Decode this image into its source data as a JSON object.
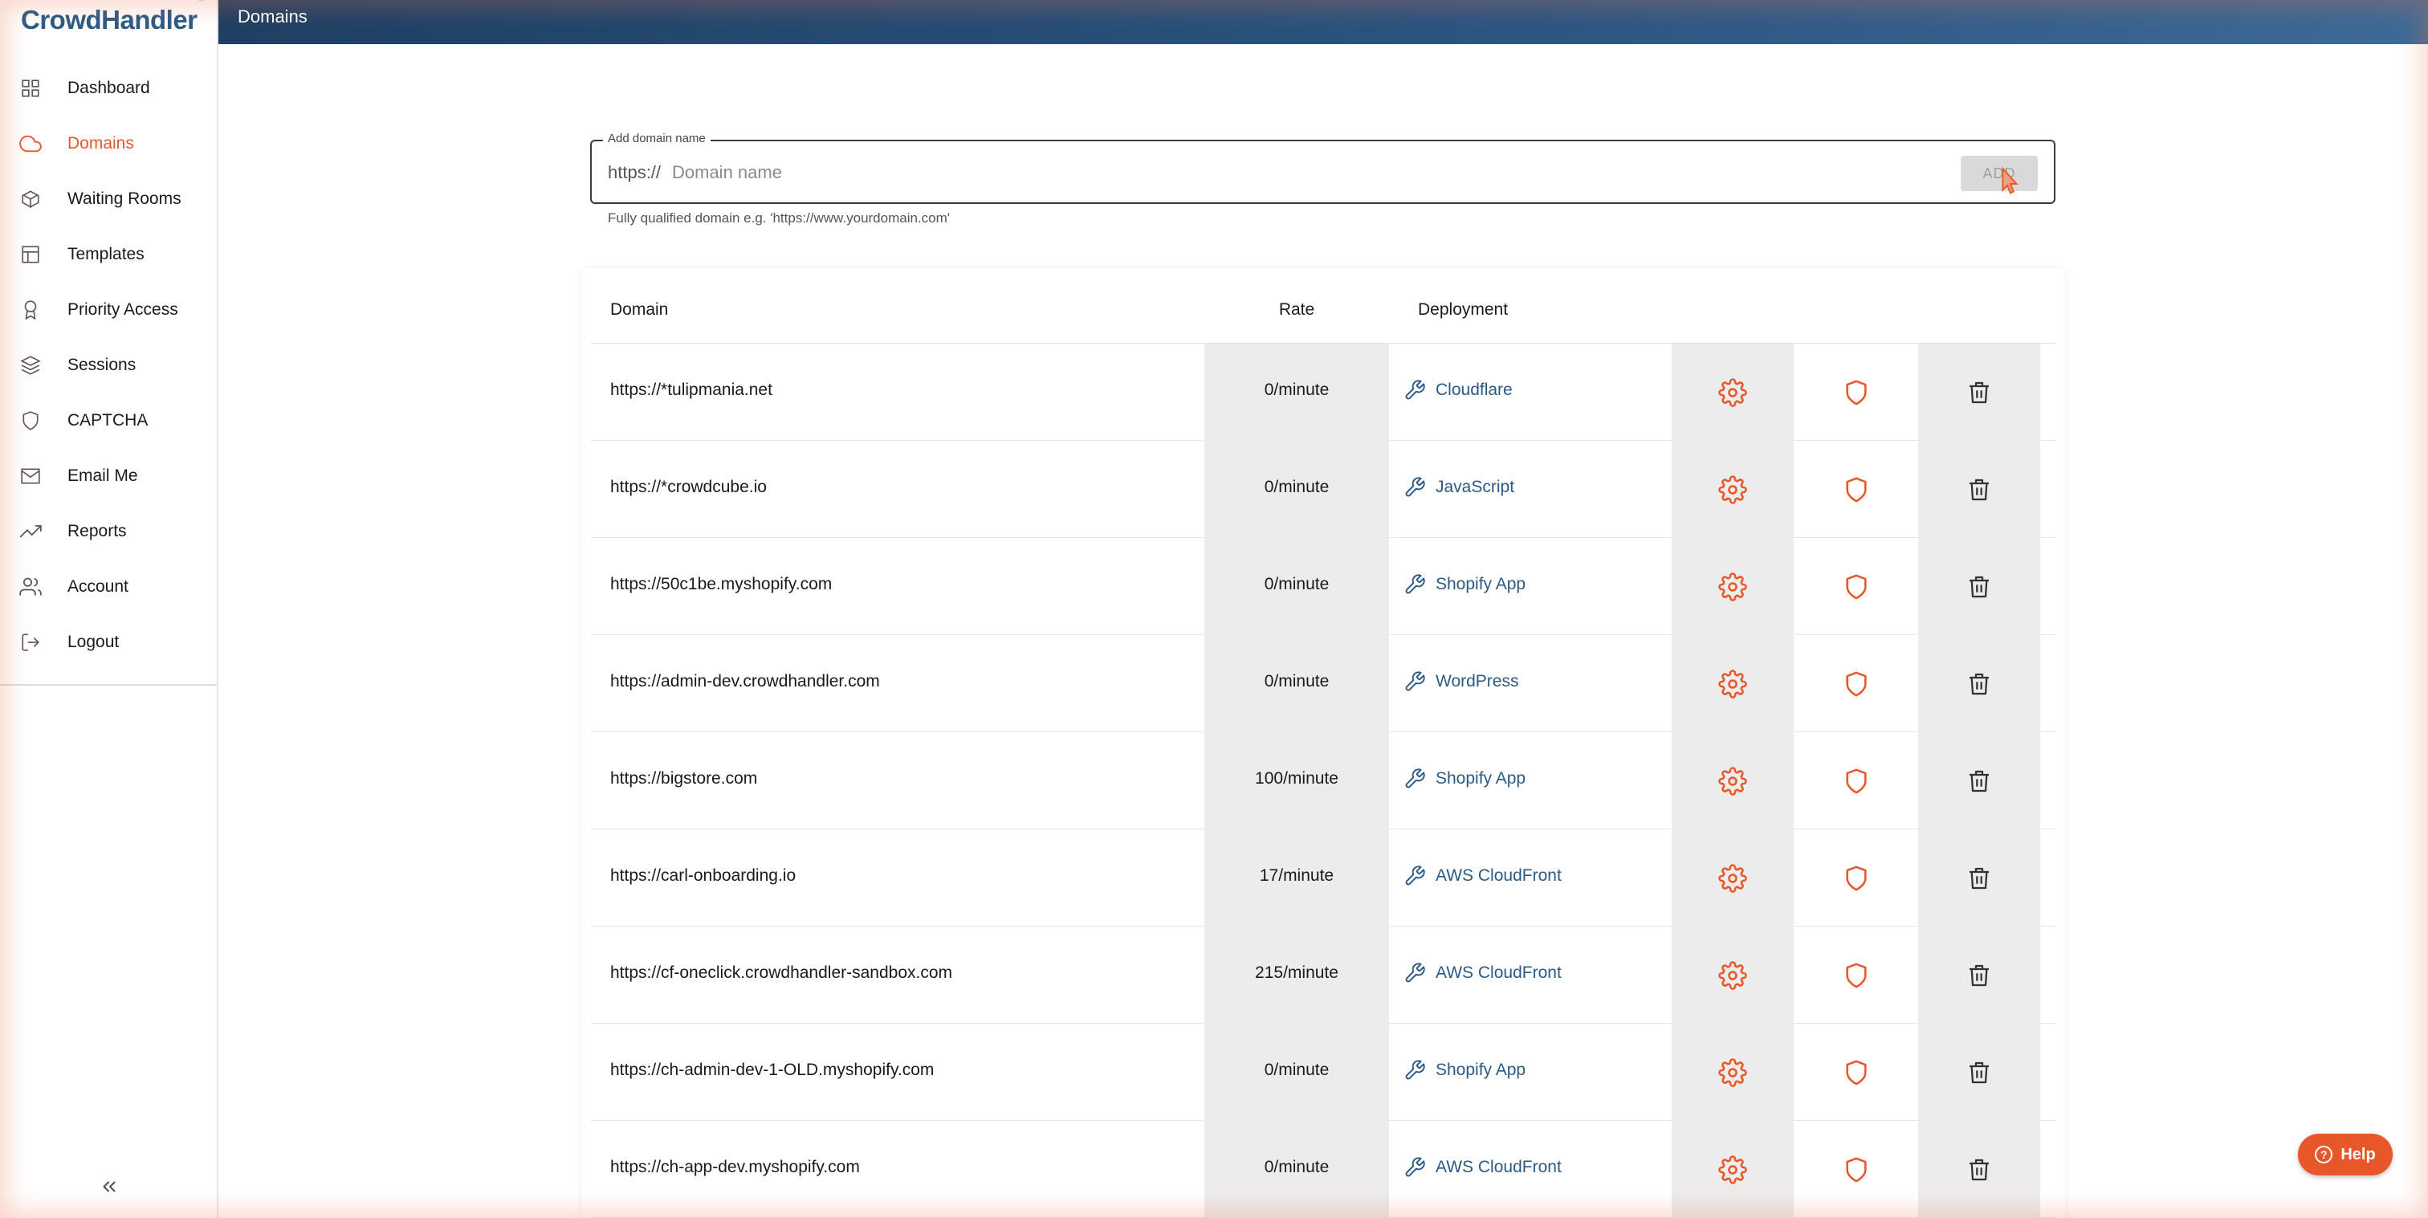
{
  "app": {
    "logo": "CrowdHandler",
    "logo_mark": "™"
  },
  "header": {
    "title": "Domains"
  },
  "sidebar": {
    "items": [
      {
        "label": "Dashboard",
        "icon": "grid-icon"
      },
      {
        "label": "Domains",
        "icon": "cloud-icon",
        "active": true
      },
      {
        "label": "Waiting Rooms",
        "icon": "cube-icon"
      },
      {
        "label": "Templates",
        "icon": "layout-icon"
      },
      {
        "label": "Priority Access",
        "icon": "award-icon"
      },
      {
        "label": "Sessions",
        "icon": "layers-icon"
      },
      {
        "label": "CAPTCHA",
        "icon": "shield-icon"
      },
      {
        "label": "Email Me",
        "icon": "mail-icon"
      },
      {
        "label": "Reports",
        "icon": "trending-up-icon"
      },
      {
        "label": "Account",
        "icon": "users-icon"
      },
      {
        "label": "Logout",
        "icon": "logout-icon"
      }
    ],
    "collapse_icon": "chevrons-left-icon"
  },
  "add_domain": {
    "legend": "Add domain name",
    "prefix": "https://",
    "value": "",
    "placeholder": "Domain name",
    "button_label": "ADD",
    "helper": "Fully qualified domain e.g. 'https://www.yourdomain.com'"
  },
  "table": {
    "headers": {
      "domain": "Domain",
      "rate": "Rate",
      "deployment": "Deployment"
    },
    "rows": [
      {
        "domain": "https://*tulipmania.net",
        "rate": "0/minute",
        "deployment": "Cloudflare"
      },
      {
        "domain": "https://*crowdcube.io",
        "rate": "0/minute",
        "deployment": "JavaScript"
      },
      {
        "domain": "https://50c1be.myshopify.com",
        "rate": "0/minute",
        "deployment": "Shopify App"
      },
      {
        "domain": "https://admin-dev.crowdhandler.com",
        "rate": "0/minute",
        "deployment": "WordPress"
      },
      {
        "domain": "https://bigstore.com",
        "rate": "100/minute",
        "deployment": "Shopify App"
      },
      {
        "domain": "https://carl-onboarding.io",
        "rate": "17/minute",
        "deployment": "AWS CloudFront"
      },
      {
        "domain": "https://cf-oneclick.crowdhandler-sandbox.com",
        "rate": "215/minute",
        "deployment": "AWS CloudFront"
      },
      {
        "domain": "https://ch-admin-dev-1-OLD.myshopify.com",
        "rate": "0/minute",
        "deployment": "Shopify App"
      },
      {
        "domain": "https://ch-app-dev.myshopify.com",
        "rate": "0/minute",
        "deployment": "AWS CloudFront"
      }
    ],
    "action_icons": [
      "gear-icon",
      "shield-icon",
      "trash-icon"
    ]
  },
  "help": {
    "label": "Help",
    "icon": "question-icon"
  },
  "colors": {
    "accent": "#e8572a",
    "brand": "#2b5a86",
    "header_start": "#1f3f63",
    "header_end": "#3e6a96"
  }
}
